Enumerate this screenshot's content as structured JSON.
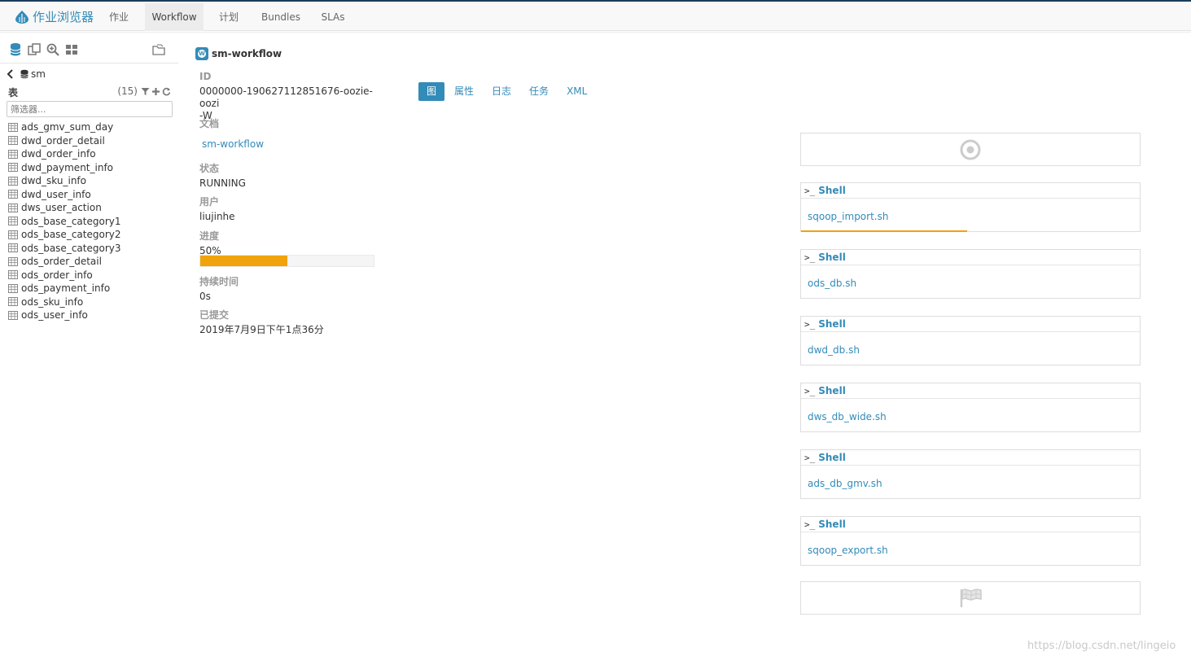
{
  "nav": {
    "brand": "作业浏览器",
    "items": [
      "作业",
      "Workflow",
      "计划",
      "Bundles",
      "SLAs"
    ],
    "active": "Workflow"
  },
  "sidebar": {
    "db_name": "sm",
    "tables_label": "表",
    "tables_count": "(15)",
    "filter_placeholder": "筛选器...",
    "tables": [
      "ads_gmv_sum_day",
      "dwd_order_detail",
      "dwd_order_info",
      "dwd_payment_info",
      "dwd_sku_info",
      "dwd_user_info",
      "dws_user_action",
      "ods_base_category1",
      "ods_base_category2",
      "ods_base_category3",
      "ods_order_detail",
      "ods_order_info",
      "ods_payment_info",
      "ods_sku_info",
      "ods_user_info"
    ]
  },
  "workflow": {
    "badge": "W",
    "title": "sm-workflow",
    "id_label": "ID",
    "id_line1": "0000000-190627112851676-oozie-oozi",
    "id_line2": "-W",
    "doc_label": "文档",
    "doc_link": "sm-workflow",
    "status_label": "状态",
    "status": "RUNNING",
    "user_label": "用户",
    "user": "liujinhe",
    "progress_label": "进度",
    "progress_text": "50%",
    "progress_value": 50,
    "duration_label": "持续时间",
    "duration": "0s",
    "submitted_label": "已提交",
    "submitted": "2019年7月9日下午1点36分"
  },
  "tabs": [
    "图",
    "属性",
    "日志",
    "任务",
    "XML"
  ],
  "tabs_active": "图",
  "graph": {
    "actions": [
      {
        "type": "Shell",
        "name": "sqoop_import.sh",
        "progress": 0.49
      },
      {
        "type": "Shell",
        "name": "ods_db.sh",
        "progress": 0
      },
      {
        "type": "Shell",
        "name": "dwd_db.sh",
        "progress": 0
      },
      {
        "type": "Shell",
        "name": "dws_db_wide.sh",
        "progress": 0
      },
      {
        "type": "Shell",
        "name": "ads_db_gmv.sh",
        "progress": 0
      },
      {
        "type": "Shell",
        "name": "sqoop_export.sh",
        "progress": 0
      }
    ]
  },
  "watermark": "https://blog.csdn.net/lingeio",
  "colors": {
    "accent": "#338bb8",
    "progress": "#f0a30a"
  }
}
